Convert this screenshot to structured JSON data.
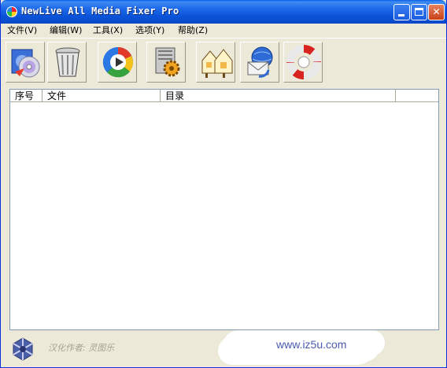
{
  "window": {
    "title": "NewLive All Media Fixer Pro",
    "controls": {
      "minimize": "minimize",
      "maximize": "maximize",
      "close": "✕"
    }
  },
  "menu": {
    "items": [
      {
        "label": "文件(V)"
      },
      {
        "label": "编辑(W)"
      },
      {
        "label": "工具(X)"
      },
      {
        "label": "选项(Y)"
      },
      {
        "label": "帮助(Z)"
      }
    ]
  },
  "toolbar": {
    "buttons": [
      {
        "icon": "add-media-icon"
      },
      {
        "icon": "trash-icon"
      },
      {
        "icon": "media-player-icon"
      },
      {
        "icon": "settings-gear-icon"
      },
      {
        "icon": "home-icon"
      },
      {
        "icon": "email-globe-icon"
      },
      {
        "icon": "help-lifebuoy-icon"
      }
    ]
  },
  "list": {
    "columns": [
      {
        "label": "序号"
      },
      {
        "label": "文件"
      },
      {
        "label": "目录"
      },
      {
        "label": ""
      }
    ],
    "rows": []
  },
  "status": {
    "credit": "汉化作者: 灵图乐",
    "url": "www.iz5u.com",
    "colors": {
      "credit": "#A4A293",
      "url": "#4A5BB0",
      "title_bar": "#0A53D8"
    }
  }
}
